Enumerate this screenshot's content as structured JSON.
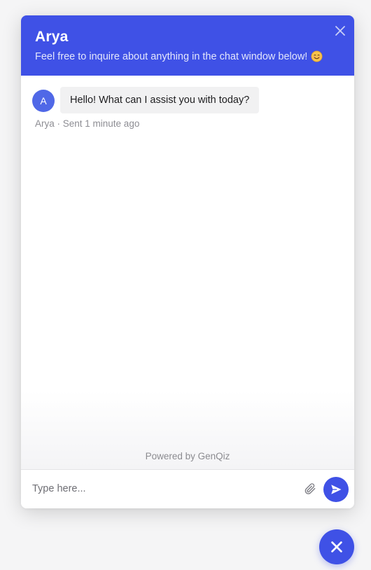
{
  "header": {
    "title": "Arya",
    "subtitle": "Feel free to inquire about anything in the chat window below!",
    "subtitle_emoji_icon": "smiling-face-emoji",
    "close_icon": "close-icon"
  },
  "messages": [
    {
      "avatar_initial": "A",
      "text": "Hello! What can I assist you with today?",
      "meta": "Arya · Sent 1 minute ago"
    }
  ],
  "footer": {
    "powered_by": "Powered by GenQiz"
  },
  "composer": {
    "placeholder": "Type here...",
    "attach_icon": "paperclip-icon",
    "send_icon": "send-icon"
  },
  "launcher": {
    "icon": "close-icon"
  },
  "colors": {
    "accent": "#3f51e6",
    "avatar": "#5068e7",
    "bubble_bg": "#f1f1f2",
    "page_bg": "#f5f5f6"
  }
}
